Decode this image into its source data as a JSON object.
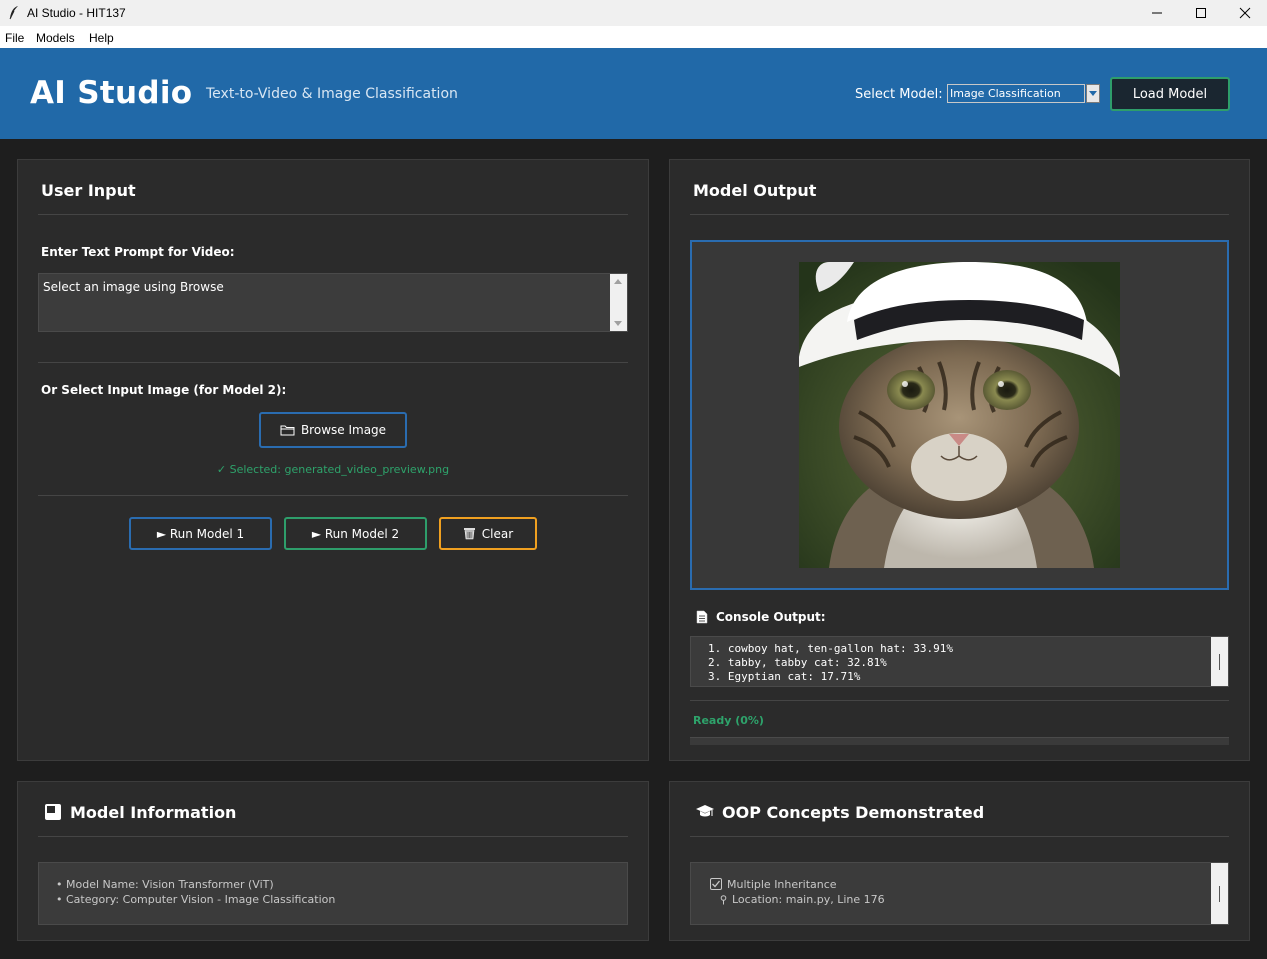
{
  "window": {
    "title": "AI Studio - HIT137"
  },
  "menu": [
    "File",
    "Models",
    "Help"
  ],
  "header": {
    "title": "AI Studio",
    "subtitle": "Text-to-Video & Image Classification",
    "select_label": "Select Model:",
    "selected_model": "Image Classification",
    "load_button": "Load Model"
  },
  "input_panel": {
    "title": "User Input",
    "prompt_label": "Enter Text Prompt for Video:",
    "prompt_value": "Select an image using Browse",
    "image_label": "Or Select Input Image (for Model 2):",
    "browse_button": "Browse Image",
    "selected_file": "✓ Selected: generated_video_preview.png",
    "run_model1": "► Run Model 1",
    "run_model2": "► Run Model 2",
    "clear_button": "Clear"
  },
  "output_panel": {
    "title": "Model Output",
    "console_label": "Console Output:",
    "console_lines": [
      "1. cowboy hat, ten-gallon hat: 33.91%",
      "2. tabby, tabby cat: 32.81%",
      "3. Egyptian cat: 17.71%"
    ],
    "status": "Ready (0%)",
    "progress_fraction": 0
  },
  "model_info": {
    "title": "Model Information",
    "lines": [
      "• Model Name: Vision Transformer (ViT)",
      "• Category: Computer Vision - Image Classification"
    ]
  },
  "oop": {
    "title": "OOP Concepts Demonstrated",
    "item_title": "Multiple Inheritance",
    "item_location": "Location: main.py, Line 176"
  },
  "colors": {
    "header_bg": "#2169a8",
    "accent_blue": "#2a6cb0",
    "accent_green": "#2e9e6b",
    "accent_orange": "#f0a020"
  }
}
